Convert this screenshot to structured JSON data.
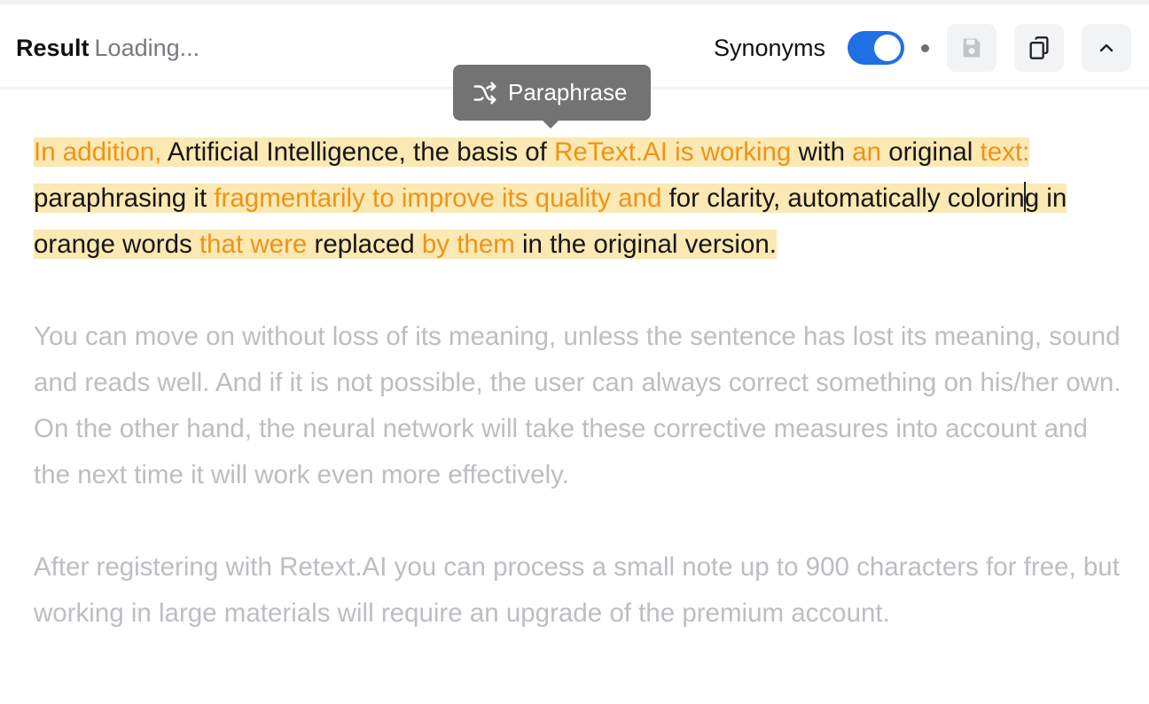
{
  "header": {
    "title": "Result",
    "status": "Loading...",
    "synonyms_label": "Synonyms",
    "synonyms_enabled": true,
    "buttons": {
      "save_icon": "floppy-disk-icon",
      "copy_icon": "copy-icon",
      "collapse_icon": "chevron-up-icon"
    }
  },
  "tooltip": {
    "text": "Paraphrase",
    "icon": "shuffle-icon"
  },
  "colors": {
    "accent": "#1f6fe5",
    "changed_text": "#ec9418",
    "highlight": "#fbe8b2",
    "dim_text": "#bdbdc2"
  },
  "paragraph1": {
    "segments": [
      {
        "text": "In addition, ",
        "changed": true
      },
      {
        "text": "Artificial Intelligence, the basis of ",
        "changed": false
      },
      {
        "text": "ReText.AI is working",
        "changed": true
      },
      {
        "text": " with ",
        "changed": false
      },
      {
        "text": "an",
        "changed": true
      },
      {
        "text": " original ",
        "changed": false
      },
      {
        "text": "text:",
        "changed": true
      },
      {
        "text": " paraphrasing it ",
        "changed": false
      },
      {
        "text": "fragmentarily to improve its quality and",
        "changed": true
      },
      {
        "text": " for clarity, automatically colorin",
        "changed": false
      },
      {
        "text": "g in orange words ",
        "changed": false
      },
      {
        "text": "that were",
        "changed": true
      },
      {
        "text": " replaced ",
        "changed": false
      },
      {
        "text": "by them",
        "changed": true
      },
      {
        "text": " in the original version.",
        "changed": false
      }
    ]
  },
  "paragraph2": "You can move on without loss of its meaning, unless the sentence has lost its meaning, sound and reads well. And if it is not possible, the user can always correct something on his/her own. On the other hand, the neural network will take these corrective measures into account and the next time it will work even more effectively.",
  "paragraph3": "After registering with Retext.AI you can process a small note up to 900 characters for free, but working in large materials will require an upgrade of the premium account."
}
